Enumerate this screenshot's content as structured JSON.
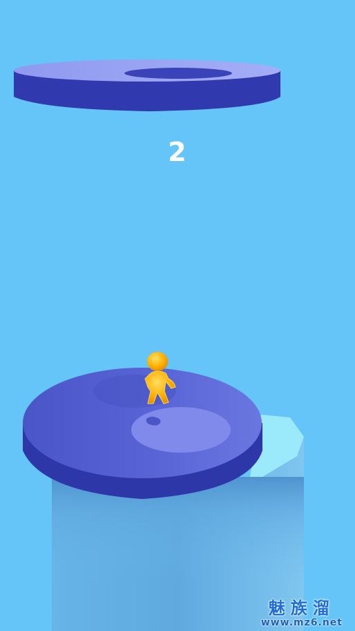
{
  "game": {
    "score": "2",
    "colors": {
      "sky": "#66c5f8",
      "platform_top": "#5b67d6",
      "platform_side": "#2f38a8",
      "ring_top": "#8f9af0",
      "pillar": "#5aa6dd",
      "pillar_cap": "#9aeafc",
      "player": "#ffb400"
    },
    "elements": {
      "ring_platform": "ring-platform",
      "disc_platform": "disc-platform",
      "player": "player-character",
      "pillar": "pillar"
    }
  },
  "watermark": {
    "cn": "魅族溜",
    "url": "www.mz6.net"
  }
}
